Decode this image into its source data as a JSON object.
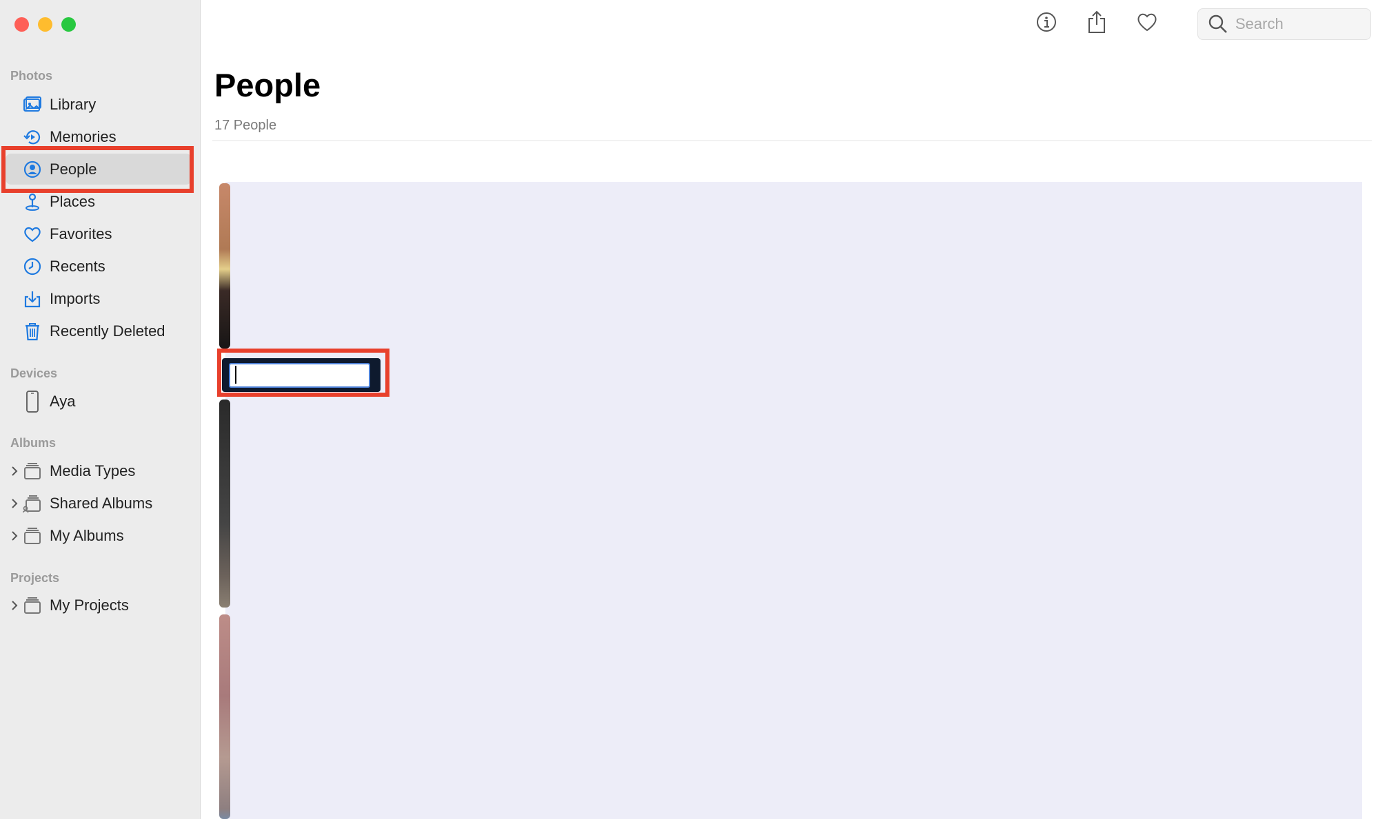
{
  "sidebar": {
    "sections": {
      "photos": "Photos",
      "devices": "Devices",
      "albums": "Albums",
      "projects": "Projects"
    },
    "items": [
      {
        "label": "Library",
        "icon": "library-icon"
      },
      {
        "label": "Memories",
        "icon": "memories-icon"
      },
      {
        "label": "People",
        "icon": "people-icon",
        "selected": true
      },
      {
        "label": "Places",
        "icon": "places-icon"
      },
      {
        "label": "Favorites",
        "icon": "heart-icon"
      },
      {
        "label": "Recents",
        "icon": "clock-icon"
      },
      {
        "label": "Imports",
        "icon": "import-icon"
      },
      {
        "label": "Recently Deleted",
        "icon": "trash-icon"
      }
    ],
    "devices": [
      {
        "label": "Aya",
        "icon": "iphone-icon"
      }
    ],
    "albums": [
      {
        "label": "Media Types",
        "icon": "album-stack-icon"
      },
      {
        "label": "Shared Albums",
        "icon": "shared-album-icon"
      },
      {
        "label": "My Albums",
        "icon": "album-stack-icon"
      }
    ],
    "projects": [
      {
        "label": "My Projects",
        "icon": "album-stack-icon"
      }
    ]
  },
  "toolbar": {
    "info_icon": "info-icon",
    "share_icon": "share-icon",
    "favorite_icon": "heart-icon",
    "search_placeholder": "Search"
  },
  "main": {
    "title": "People",
    "subtitle": "17 People",
    "name_field_value": ""
  },
  "colors": {
    "accent": "#1f7ae0",
    "highlight": "#e8402c",
    "grid_background": "#ededf8"
  }
}
